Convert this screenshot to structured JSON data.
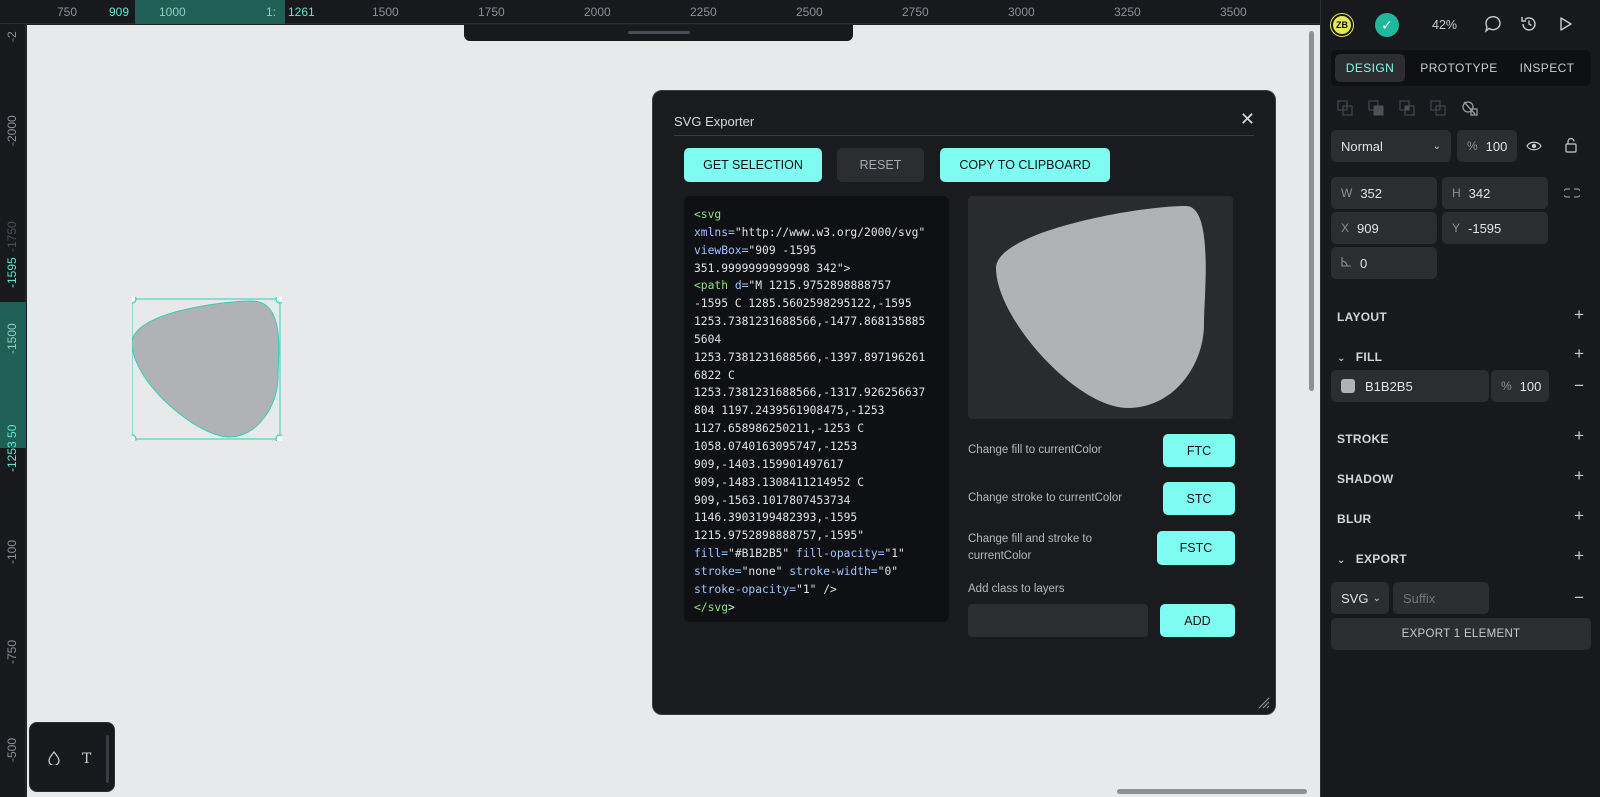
{
  "ruler": {
    "top_ticks": [
      "750",
      "909",
      "1000",
      "1:",
      "1261",
      "1500",
      "1750",
      "2000",
      "2250",
      "2500",
      "2750",
      "3000",
      "3250",
      "3500"
    ],
    "left_ticks": [
      "-2",
      "-2000",
      "-1750",
      "-1595",
      "-1500",
      "-1253 50",
      "-100",
      "-750",
      "-500"
    ]
  },
  "canvas": {
    "fill_color": "#B1B2B5",
    "selection_color": "#31d0b8",
    "tools": [
      "drop-icon",
      "T"
    ]
  },
  "exporter": {
    "title": "SVG Exporter",
    "close_glyph": "✕",
    "get_selection": "GET SELECTION",
    "reset": "RESET",
    "copy": "COPY TO CLIPBOARD",
    "code_lines": [
      [
        [
          "tag",
          "<svg"
        ]
      ],
      [
        [
          "attr",
          "xmlns="
        ],
        [
          "val",
          "\"http://www.w3.org/2000/svg\""
        ]
      ],
      [
        [
          "attr",
          "viewBox="
        ],
        [
          "val",
          "\"909 -1595"
        ]
      ],
      [
        [
          "val",
          "351.9999999999998 342\">"
        ]
      ],
      [
        [
          "tag",
          "<path "
        ],
        [
          "attr",
          "d="
        ],
        [
          "val",
          "\"M 1215.9752898888757"
        ]
      ],
      [
        [
          "val",
          "-1595 C 1285.5602598295122,-1595"
        ]
      ],
      [
        [
          "val",
          "1253.7381231688566,-1477.868135885"
        ]
      ],
      [
        [
          "val",
          "5604"
        ]
      ],
      [
        [
          "val",
          "1253.7381231688566,-1397.897196261"
        ]
      ],
      [
        [
          "val",
          "6822 C"
        ]
      ],
      [
        [
          "val",
          "1253.7381231688566,-1317.926256637"
        ]
      ],
      [
        [
          "val",
          "804 1197.2439561908475,-1253"
        ]
      ],
      [
        [
          "val",
          "1127.658986250211,-1253 C"
        ]
      ],
      [
        [
          "val",
          "1058.0740163095747,-1253"
        ]
      ],
      [
        [
          "val",
          "909,-1403.159901497617"
        ]
      ],
      [
        [
          "val",
          "909,-1483.1308411214952 C"
        ]
      ],
      [
        [
          "val",
          "909,-1563.1017807453734"
        ]
      ],
      [
        [
          "val",
          "1146.3903199482393,-1595"
        ]
      ],
      [
        [
          "val",
          "1215.9752898888757,-1595\""
        ]
      ],
      [
        [
          "attr",
          "fill="
        ],
        [
          "val",
          "\"#B1B2B5\" "
        ],
        [
          "attr",
          "fill-opacity="
        ],
        [
          "val",
          "\"1\""
        ]
      ],
      [
        [
          "attr",
          "stroke="
        ],
        [
          "val",
          "\"none\" "
        ],
        [
          "attr",
          "stroke-width="
        ],
        [
          "val",
          "\"0\""
        ]
      ],
      [
        [
          "attr",
          "stroke-opacity="
        ],
        [
          "val",
          "\"1\" />"
        ]
      ],
      [
        [
          "tag",
          "</svg"
        ],
        [
          "val",
          ">"
        ]
      ]
    ],
    "options": [
      {
        "label": "Change fill to currentColor",
        "button": "FTC"
      },
      {
        "label": "Change stroke to currentColor",
        "button": "STC"
      },
      {
        "label": "Change fill and stroke to currentColor",
        "button": "FSTC"
      }
    ],
    "add_class_label": "Add class to layers",
    "add_button": "ADD"
  },
  "panel": {
    "avatar": "ZB",
    "zoom": "42%",
    "tabs": [
      "DESIGN",
      "PROTOTYPE",
      "INSPECT"
    ],
    "blend_mode": "Normal",
    "opacity_unit": "%",
    "opacity": "100",
    "w_label": "W",
    "w": "352",
    "h_label": "H",
    "h": "342",
    "x_label": "X",
    "x": "909",
    "y_label": "Y",
    "y": "-1595",
    "rotation": "0",
    "sections": {
      "layout": "LAYOUT",
      "fill": "FILL",
      "stroke": "STROKE",
      "shadow": "SHADOW",
      "blur": "BLUR",
      "export": "EXPORT"
    },
    "fill_hex": "B1B2B5",
    "fill_opacity_unit": "%",
    "fill_opacity": "100",
    "export_format": "SVG",
    "export_suffix_placeholder": "Suffix",
    "export_button": "EXPORT 1 ELEMENT"
  }
}
